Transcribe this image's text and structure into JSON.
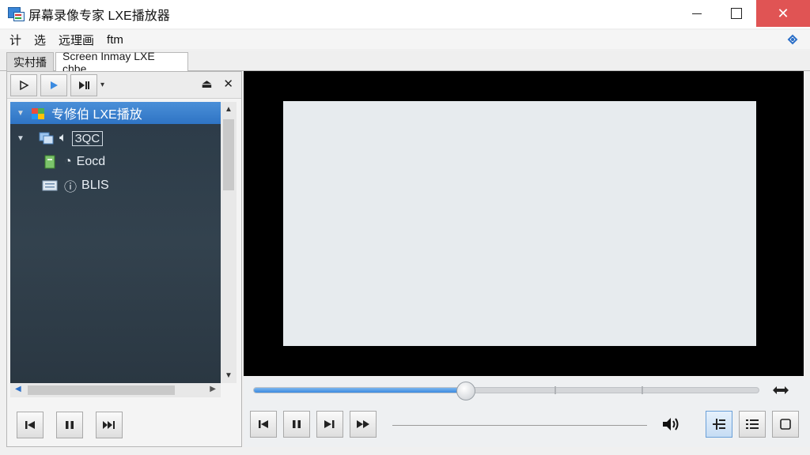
{
  "window": {
    "title": "屏幕录像专家 LXE播放器"
  },
  "menu": {
    "items": [
      "计",
      "选",
      "远理画",
      "ftm"
    ]
  },
  "tabs": [
    {
      "label": "实村播"
    },
    {
      "label": "Screen Inmay LXE chbe"
    }
  ],
  "tree": {
    "items": [
      {
        "label": "专修伯 LXE播放",
        "selected": true
      },
      {
        "label": "ЗQC"
      },
      {
        "label": "Eocd"
      },
      {
        "label": "BLIS"
      }
    ]
  },
  "playback": {
    "progress_fraction": 0.42
  },
  "colors": {
    "accent": "#3b8ae0",
    "close_button": "#e05454",
    "tree_background": "#2f3e4b"
  }
}
